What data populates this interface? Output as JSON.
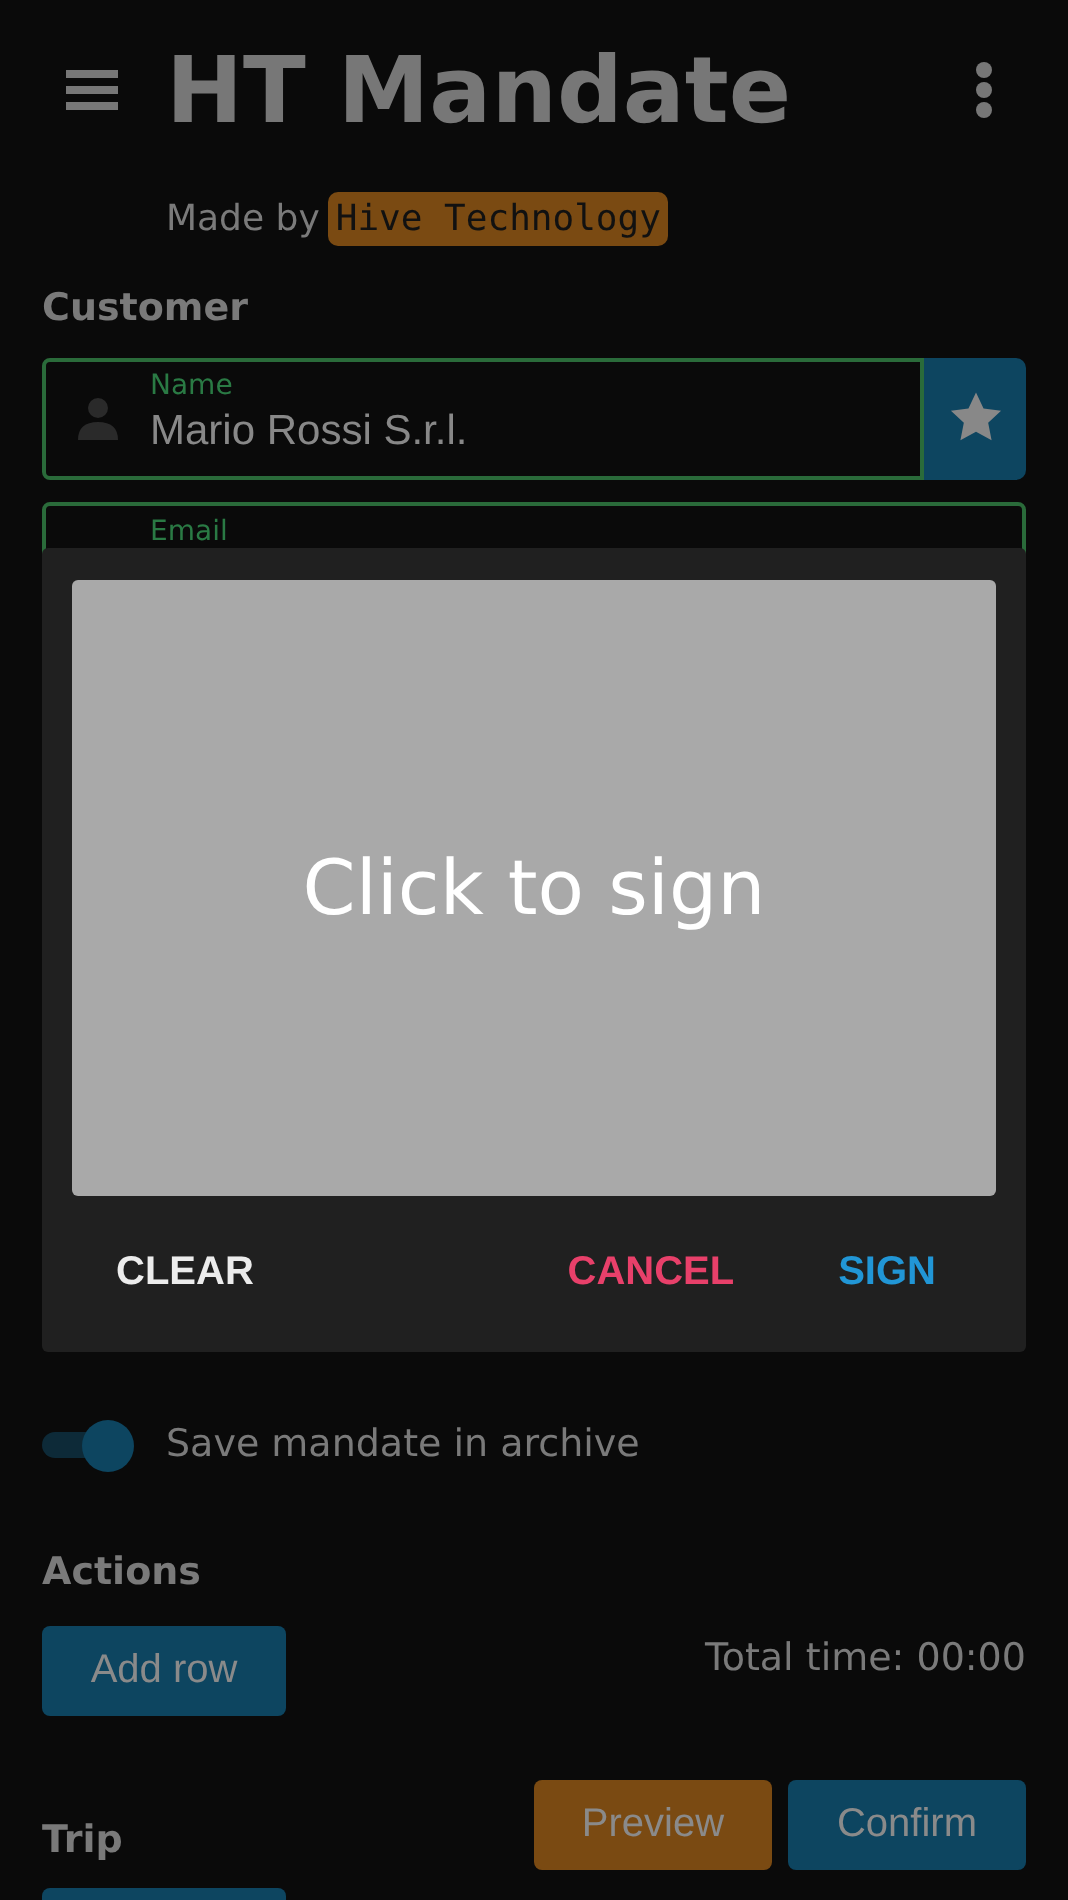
{
  "app_bar": {
    "title": "HT Mandate"
  },
  "credit": {
    "prefix": "Made by",
    "brand": "Hive Technology"
  },
  "customer": {
    "heading": "Customer",
    "fields": [
      {
        "label": "Name",
        "value": "Mario Rossi S.r.l."
      },
      {
        "label": "Email"
      }
    ]
  },
  "archive_switch": {
    "label": "Save mandate in archive",
    "on": true
  },
  "actions": {
    "heading": "Actions",
    "add_button": "Add row",
    "total_time": "Total time: 00:00"
  },
  "trip": {
    "heading": "Trip"
  },
  "footer_buttons": [
    {
      "label": "Preview",
      "kind": "warning"
    },
    {
      "label": "Confirm",
      "kind": "primary"
    }
  ],
  "dialog": {
    "pad_text": "Click to sign",
    "buttons": [
      {
        "label": "CLEAR",
        "kind": "neutral"
      },
      {
        "label": "CANCEL",
        "kind": "danger"
      },
      {
        "label": "SIGN",
        "kind": "primary"
      }
    ]
  }
}
